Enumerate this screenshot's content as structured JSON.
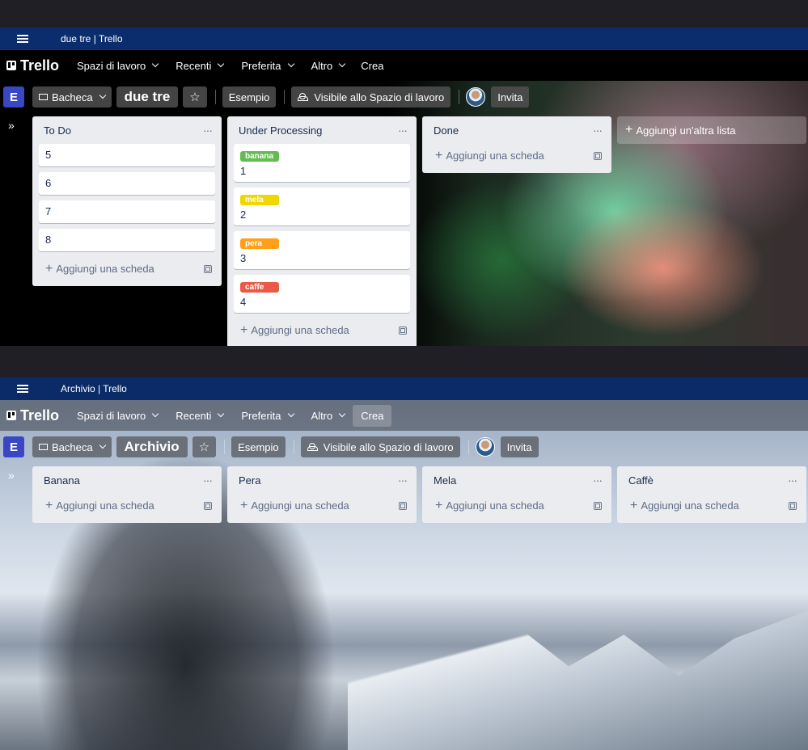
{
  "window1": {
    "title": "due tre | Trello",
    "nav": {
      "logo": "Trello",
      "items": [
        "Spazi di lavoro",
        "Recenti",
        "Preferita",
        "Altro"
      ],
      "create": "Crea"
    },
    "boardbar": {
      "workspace_initial": "E",
      "view": "Bacheca",
      "board_name": "due tre",
      "workspace_name": "Esempio",
      "visibility": "Visibile allo Spazio di lavoro",
      "invite": "Invita"
    },
    "lists": [
      {
        "title": "To Do",
        "cards": [
          {
            "text": "5"
          },
          {
            "text": "6"
          },
          {
            "text": "7"
          },
          {
            "text": "8"
          }
        ],
        "add_card": "Aggiungi una scheda"
      },
      {
        "title": "Under Processing",
        "cards": [
          {
            "label": "banana",
            "label_color": "#61bd4f",
            "text": "1"
          },
          {
            "label": "mela",
            "label_color": "#f2d600",
            "text": "2"
          },
          {
            "label": "pera",
            "label_color": "#ff9f1a",
            "text": "3"
          },
          {
            "label": "caffe",
            "label_color": "#eb5a46",
            "text": "4"
          }
        ],
        "add_card": "Aggiungi una scheda"
      },
      {
        "title": "Done",
        "cards": [],
        "add_card": "Aggiungi una scheda"
      }
    ],
    "add_list": "Aggiungi un'altra lista"
  },
  "window2": {
    "title": "Archivio | Trello",
    "nav": {
      "logo": "Trello",
      "items": [
        "Spazi di lavoro",
        "Recenti",
        "Preferita",
        "Altro"
      ],
      "create": "Crea"
    },
    "boardbar": {
      "workspace_initial": "E",
      "view": "Bacheca",
      "board_name": "Archivio",
      "workspace_name": "Esempio",
      "visibility": "Visibile allo Spazio di lavoro",
      "invite": "Invita"
    },
    "lists": [
      {
        "title": "Banana",
        "add_card": "Aggiungi una scheda"
      },
      {
        "title": "Pera",
        "add_card": "Aggiungi una scheda"
      },
      {
        "title": "Mela",
        "add_card": "Aggiungi una scheda"
      },
      {
        "title": "Caffè",
        "add_card": "Aggiungi una scheda"
      }
    ]
  }
}
